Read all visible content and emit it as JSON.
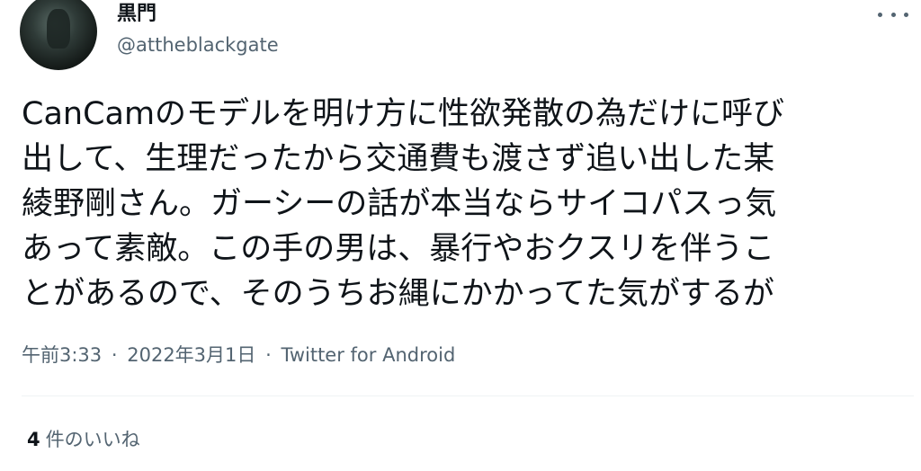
{
  "author": {
    "display_name": "黒門",
    "username": "@attheblackgate"
  },
  "tweet": {
    "text": "CanCamのモデルを明け方に性欲発散の為だけに呼び\n出して、生理だったから交通費も渡さず追い出した某\n綾野剛さん。ガーシーの話が本当ならサイコパスっ気\nあって素敵。この手の男は、暴行やおクスリを伴うこ\nとがあるので、そのうちお縄にかかってた気がするが"
  },
  "meta": {
    "time": "午前3:33",
    "separator": "·",
    "date": "2022年3月1日",
    "source": "Twitter for Android"
  },
  "likes": {
    "count": "4",
    "label": "件のいいね"
  },
  "icons": {
    "more": "more-horizontal-icon",
    "avatar": "profile-avatar"
  },
  "colors": {
    "primary_text": "#0f1419",
    "secondary_text": "#536471",
    "divider": "#eff3f4"
  }
}
